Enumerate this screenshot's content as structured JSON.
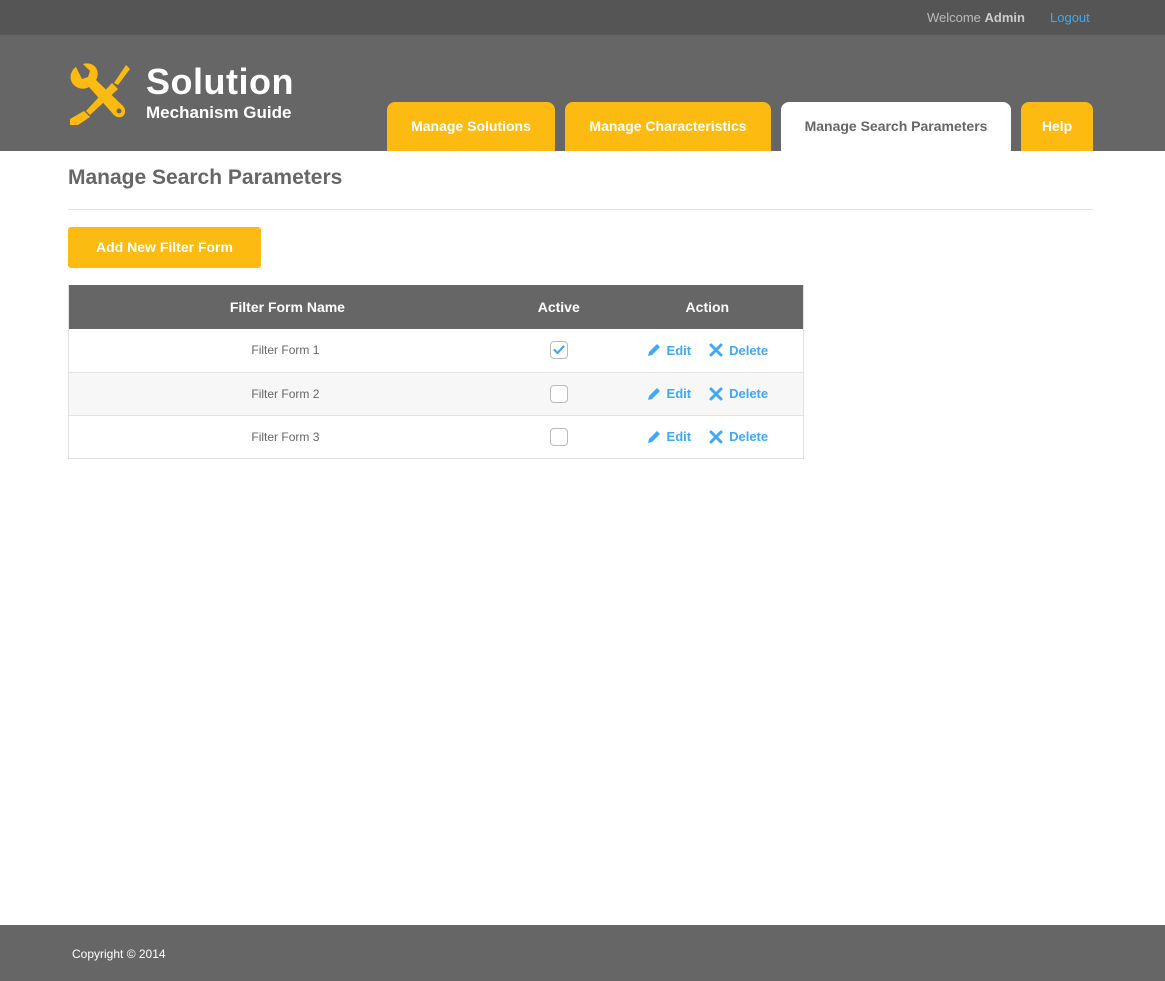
{
  "topbar": {
    "welcome_prefix": "Welcome",
    "user_name": "Admin",
    "logout_label": "Logout"
  },
  "logo": {
    "title": "Solution",
    "subtitle": "Mechanism Guide",
    "icon": "tools-icon"
  },
  "nav": {
    "tabs": [
      {
        "label": "Manage Solutions",
        "active": false
      },
      {
        "label": "Manage Characteristics",
        "active": false
      },
      {
        "label": "Manage Search Parameters",
        "active": true
      },
      {
        "label": "Help",
        "active": false
      }
    ]
  },
  "main": {
    "title": "Manage Search Parameters",
    "add_button_label": "Add New Filter Form",
    "table": {
      "headers": [
        "Filter Form Name",
        "Active",
        "Action"
      ],
      "edit_label": "Edit",
      "delete_label": "Delete",
      "rows": [
        {
          "name": "Filter Form 1",
          "active": true
        },
        {
          "name": "Filter Form 2",
          "active": false
        },
        {
          "name": "Filter Form 3",
          "active": false
        }
      ]
    }
  },
  "footer": {
    "copyright": "Copyright © 2014"
  },
  "colors": {
    "accent": "#fdbb11",
    "link": "#3fa9f5",
    "header_bg": "#666666",
    "topbar_bg": "#555555"
  }
}
